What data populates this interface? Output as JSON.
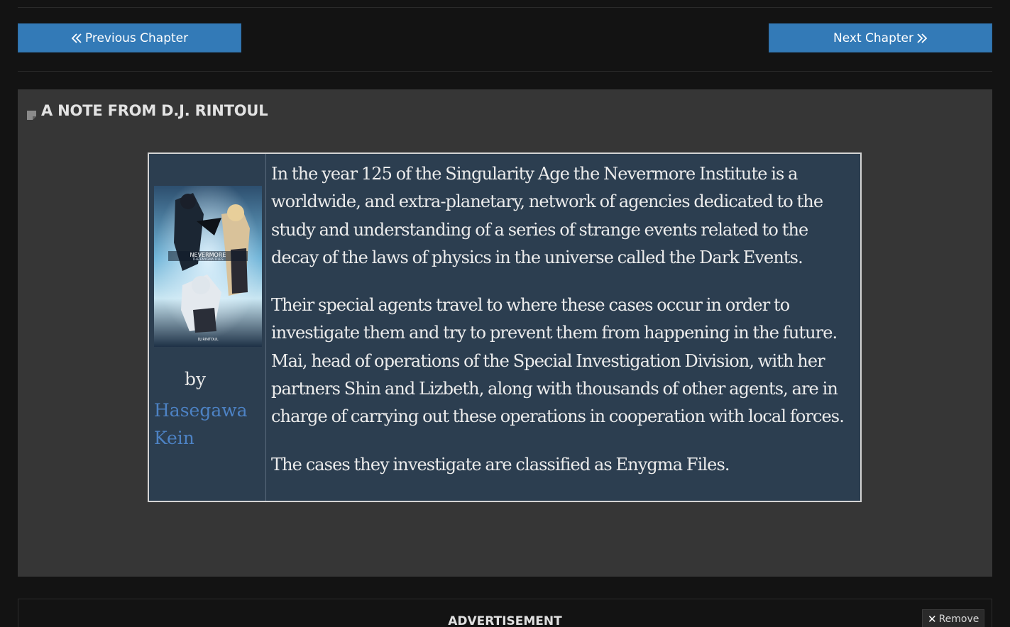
{
  "navigation": {
    "previous_label": "Previous Chapter",
    "next_label": "Next Chapter",
    "previous_icon": "double-chevron-left-icon",
    "next_icon": "double-chevron-right-icon",
    "button_color": "#337ab7"
  },
  "author_note": {
    "title": "A NOTE FROM D.J. RINTOUL",
    "icon": "note-icon",
    "cover": {
      "title_text": "NEVERMORE",
      "subtitle_text": "THE ENYGMA FILES",
      "author_text": "DJ RINTOUL"
    },
    "by_label": "by",
    "author_name": "Hasegawa Kein",
    "author_link_color": "#4d82c4",
    "paragraphs": [
      "In the year 125 of the Singularity Age the Nevermore Institute is a worldwide, and extra-planetary, network of agencies dedicated to the study and understanding of a series of strange events related to the decay of the laws of physics in the universe called the Dark Events.",
      "Their special agents travel to where these cases occur in order to investigate them and try to prevent them from happening in the future. Mai, head of operations of the Special Investigation Division, with her partners Shin and Lizbeth, along with thousands of other agents, are in charge of carrying out these operations in cooperation with local forces.",
      "The cases they investigate are classified as Enygma Files."
    ],
    "panel_color": "#2c3e50"
  },
  "advertisement": {
    "label": "ADVERTISEMENT",
    "remove_label": "Remove",
    "remove_icon": "close-icon"
  }
}
